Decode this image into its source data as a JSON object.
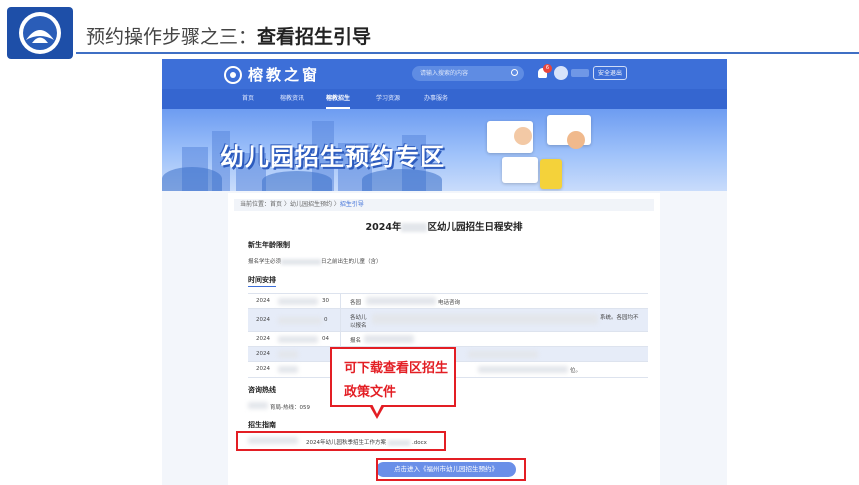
{
  "slide": {
    "title_prefix": "预约操作步骤之三：",
    "title_bold": "查看招生引导"
  },
  "site": {
    "brand": "榕教之窗",
    "search_placeholder": "请输入搜索的内容",
    "notification_count": "6",
    "logout_label": "安全退出",
    "nav": [
      "首页",
      "榕教资讯",
      "榕教招生",
      "学习资源",
      "办事服务"
    ],
    "active_nav": "榕教招生",
    "banner_title": "幼儿园招生预约专区"
  },
  "page": {
    "breadcrumb": {
      "prefix": "当前位置：",
      "home": "首页",
      "sep": " 〉",
      "section": "幼儿园招生预约",
      "current": "招生引导"
    },
    "title_start": "2024年",
    "title_end": "区幼儿园招生日程安排",
    "age_heading": "新生年龄限制",
    "age_text_start": "报名学生必须",
    "age_text_end": "日之前出生的儿童（含）",
    "schedule_heading": "时间安排",
    "schedule_rows": [
      {
        "date": "2024",
        "date_tail": "30",
        "event": "各园",
        "event_tail": "电话咨询"
      },
      {
        "date": "2024",
        "date_tail": "0",
        "event": "各幼儿",
        "event2": "以报名",
        "event_tail": "系统。各园均不"
      },
      {
        "date": "2024",
        "date_tail": "04",
        "event": "报名",
        "event_tail": ""
      },
      {
        "date": "2024",
        "date_tail": "",
        "event": "",
        "event_tail": ""
      },
      {
        "date": "2024",
        "date_tail": "",
        "event": "",
        "event_tail": "位。"
      }
    ],
    "hotline_heading": "咨询热线",
    "hotline_text": "育局-热线：059",
    "guide_heading": "招生指南",
    "guide_file": "2024年幼儿园秋季招生工作方案",
    "guide_ext": ".docx",
    "enter_button": "点击进入《福州市幼儿园招生预约》"
  },
  "annotation": {
    "callout_text": "可下载查看区招生政策文件"
  },
  "colors": {
    "brand_blue": "#3d6fd8",
    "annotation_red": "#e31e24"
  }
}
